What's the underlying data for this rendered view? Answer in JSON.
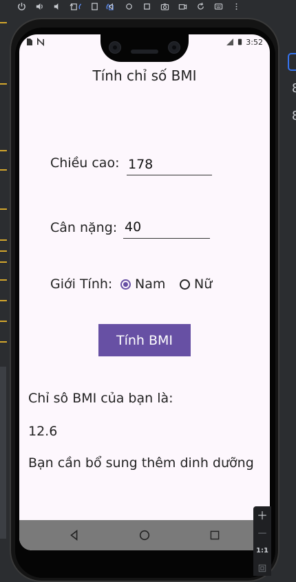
{
  "app": {
    "title": "Tính chỉ số BMI"
  },
  "status_bar": {
    "time": "3:52"
  },
  "form": {
    "height_label": "Chiều cao:",
    "height_value": "178",
    "weight_label": "Cân nặng:",
    "weight_value": "40",
    "gender_label": "Giới Tính:",
    "gender_options": [
      "Nam",
      "Nữ"
    ],
    "gender_selected": "Nam"
  },
  "button": {
    "calculate_label": "Tính BMI"
  },
  "result": {
    "label": "Chỉ sô BMI của bạn là:",
    "value": "12.6",
    "advice": "Bạn cần bổ sung thêm dinh dưỡng"
  },
  "emulator": {
    "right_digits": [
      "8",
      "8"
    ],
    "zoom_ratio_label": "1:1"
  },
  "colors": {
    "accent": "#6750a4",
    "screen_bg": "#fdf7fd",
    "nav_bar": "#7a7a7a"
  }
}
